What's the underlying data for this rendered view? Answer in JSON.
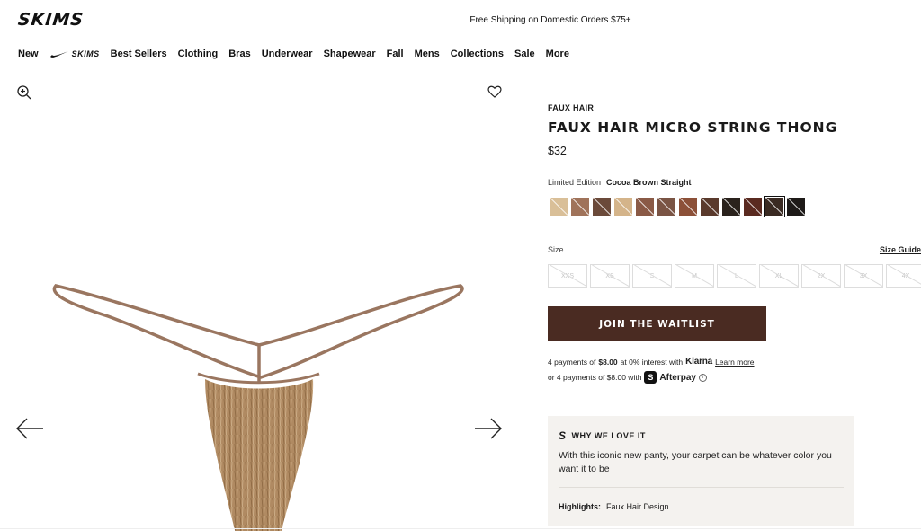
{
  "header": {
    "logo": "SKIMS",
    "promo": "Free Shipping on Domestic Orders $75+"
  },
  "nav": {
    "items": [
      "New",
      "Best Sellers",
      "Clothing",
      "Bras",
      "Underwear",
      "Shapewear",
      "Fall",
      "Mens",
      "Collections",
      "Sale",
      "More"
    ],
    "collab_label": "SKIMS"
  },
  "gallery": {
    "icons": [
      "zoom-in-icon",
      "heart-icon",
      "arrow-left-icon",
      "arrow-right-icon"
    ]
  },
  "product": {
    "brand": "FAUX HAIR",
    "title": "FAUX HAIR MICRO STRING THONG",
    "price": "$32",
    "edition": "Limited Edition",
    "color_name": "Cocoa Brown Straight",
    "swatches": [
      "#d9bf98",
      "#a0735a",
      "#6b4a3a",
      "#d4b48a",
      "#8a5a46",
      "#7a5444",
      "#8c5038",
      "#5a3a2c",
      "#2a221c",
      "#5a2a20",
      "#3a2a22",
      "#1e1a18"
    ],
    "selected_swatch": 10,
    "size_label": "Size",
    "size_guide": "Size Guide",
    "sizes": [
      "XXS",
      "XS",
      "S",
      "M",
      "L",
      "XL",
      "2X",
      "3X",
      "4X"
    ],
    "waitlist_button": "JOIN THE WAITLIST"
  },
  "payments": {
    "klarna_prefix": "4 payments of",
    "klarna_amount": "$8.00",
    "klarna_mid": "at 0% interest with",
    "klarna_name": "Klarna",
    "learn_more": "Learn more",
    "afterpay_prefix": "or 4 payments of $8.00 with",
    "afterpay_name": "Afterpay"
  },
  "why_we_love_it": {
    "heading": "WHY WE LOVE IT",
    "text": "With this iconic new panty, your carpet can be whatever color you want it to be",
    "highlights_label": "Highlights:",
    "highlights_value": "Faux Hair Design"
  },
  "colors": {
    "button_bg": "#4a2b22",
    "panel_bg": "#f4f2ef"
  }
}
